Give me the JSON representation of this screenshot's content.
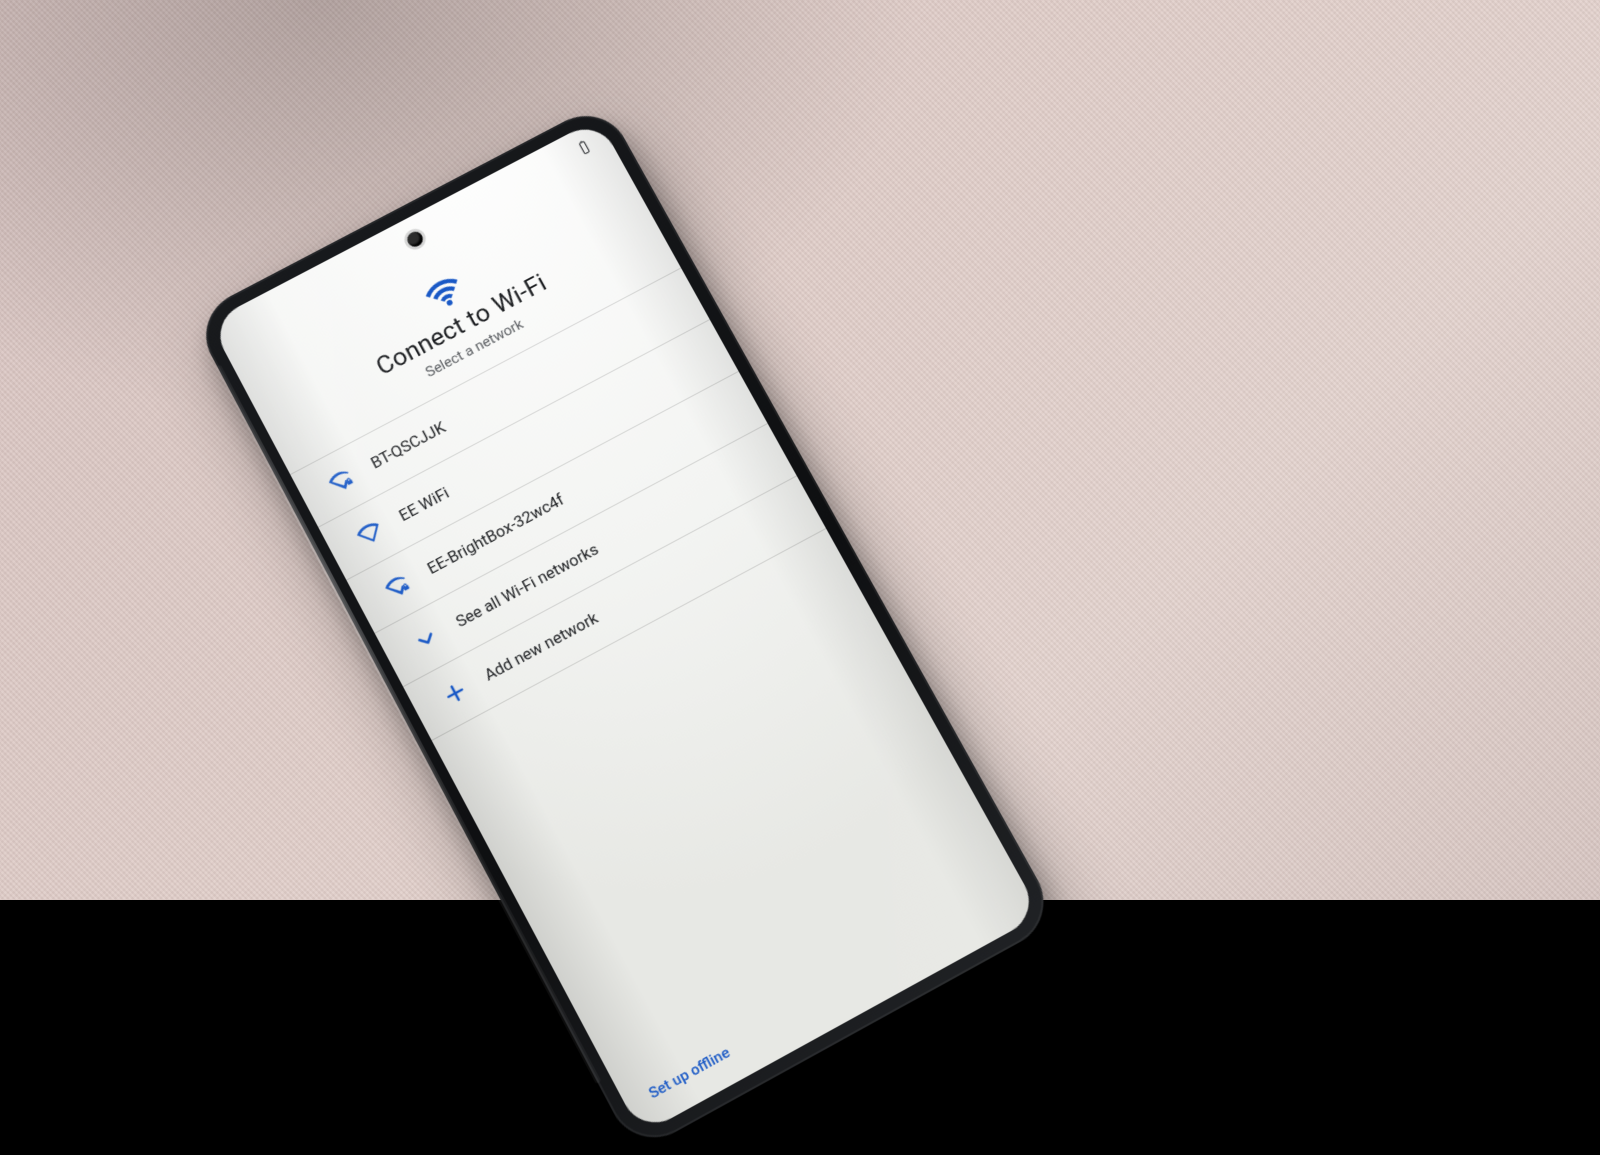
{
  "colors": {
    "accent": "#1a59c6"
  },
  "statusbar": {
    "battery_icon": "battery-outline"
  },
  "header": {
    "icon": "wifi-icon",
    "title": "Connect to Wi-Fi",
    "subtitle": "Select a network"
  },
  "networks": [
    {
      "ssid": "BT-QSCJJK",
      "icon": "wifi-lock-icon"
    },
    {
      "ssid": "EE WiFi",
      "icon": "wifi-icon"
    },
    {
      "ssid": "EE-BrightBox-32wc4f",
      "icon": "wifi-lock-icon"
    }
  ],
  "actions": {
    "see_all": {
      "label": "See all Wi-Fi networks",
      "icon": "chevron-down-icon"
    },
    "add": {
      "label": "Add new network",
      "icon": "plus-icon"
    }
  },
  "footer": {
    "setup_offline": "Set up offline"
  }
}
